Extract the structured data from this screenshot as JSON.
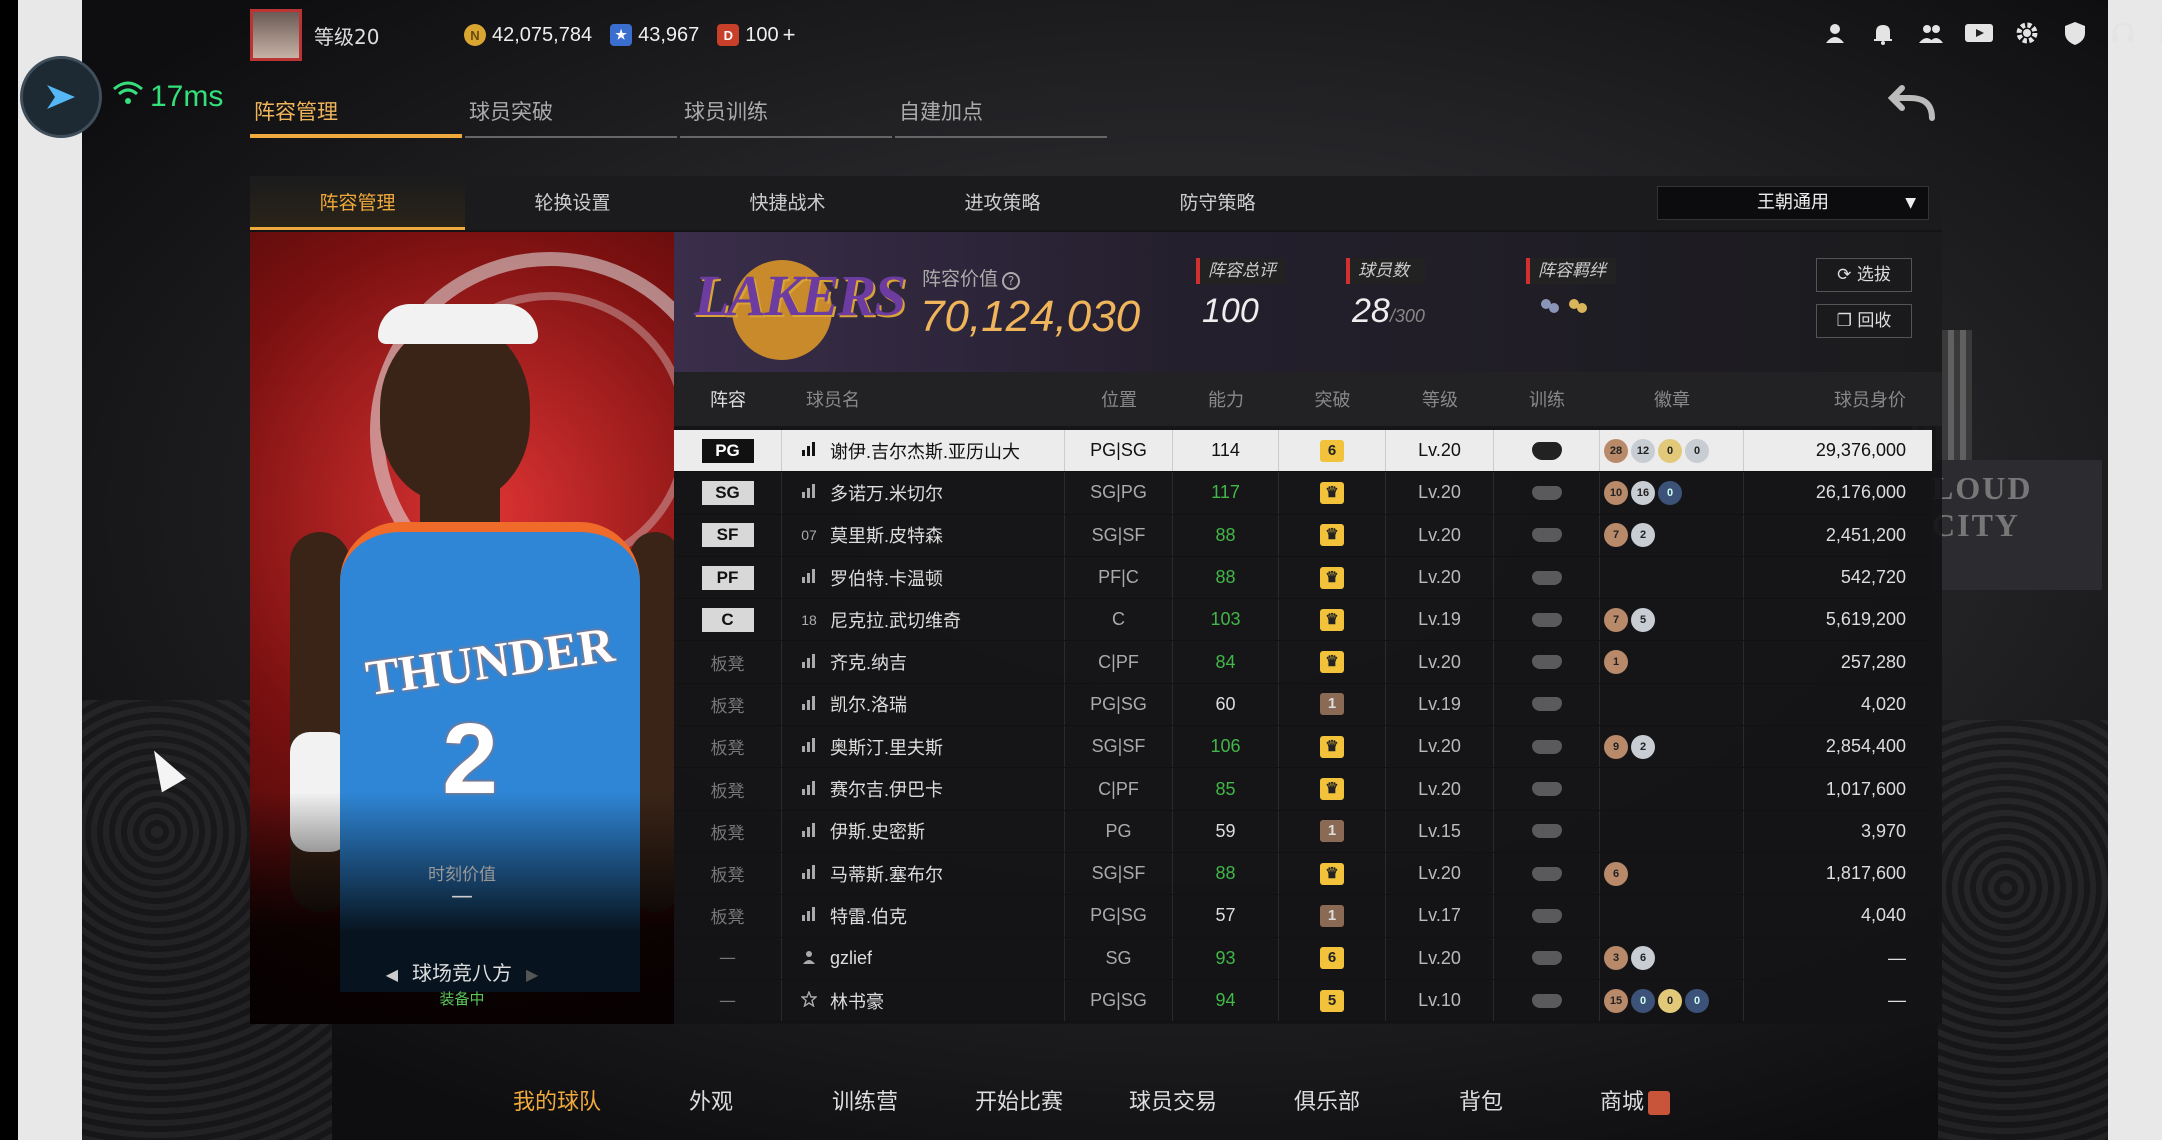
{
  "network": {
    "ping": "17ms"
  },
  "player_bar": {
    "level": "等级20",
    "gold": "42,075,784",
    "stars": "43,967",
    "tokens": "100",
    "plus": "+"
  },
  "top_icons": [
    "profile-icon",
    "bell-icon",
    "friends-icon",
    "video-icon",
    "gear-icon",
    "shield-icon",
    "headset-icon",
    "exit-icon"
  ],
  "main_tabs": [
    {
      "label": "阵容管理",
      "active": true
    },
    {
      "label": "球员突破",
      "active": false
    },
    {
      "label": "球员训练",
      "active": false
    },
    {
      "label": "自建加点",
      "active": false
    }
  ],
  "sub_tabs": [
    {
      "label": "阵容管理",
      "active": true
    },
    {
      "label": "轮换设置",
      "active": false
    },
    {
      "label": "快捷战术",
      "active": false
    },
    {
      "label": "进攻策略",
      "active": false
    },
    {
      "label": "防守策略",
      "active": false
    }
  ],
  "dropdown": {
    "selected": "王朝通用"
  },
  "card": {
    "moment_label": "时刻价值",
    "moment_value": "—",
    "card_name": "球场竞八方",
    "equipped": "装备中"
  },
  "team": {
    "logo_text": "LAKERS",
    "lineup_value_label": "阵容价值",
    "lineup_value": "70,124,030",
    "rating_label": "阵容总评",
    "rating": "100",
    "players_label": "球员数",
    "players": "28",
    "players_max": "/300",
    "bond_label": "阵容羁绊",
    "scout_btn": "选拔",
    "recycle_btn": "回收"
  },
  "table": {
    "headers": [
      "阵容",
      "球员名",
      "位置",
      "能力",
      "突破",
      "等级",
      "训练",
      "徽章",
      "球员身价"
    ],
    "rows": [
      {
        "slot": "PG",
        "name": "谢伊.吉尔杰斯.亚历山大",
        "pos": "PG|SG",
        "ability": "114",
        "ability_green": false,
        "break": "6",
        "break_style": "gold",
        "level": "Lv.20",
        "badges": [
          [
            "28",
            "bronze"
          ],
          [
            "12",
            "silver"
          ],
          [
            "0",
            "gold"
          ],
          [
            "0",
            "silver"
          ]
        ],
        "value": "29,376,000",
        "selected": true
      },
      {
        "slot": "SG",
        "name": "多诺万.米切尔",
        "pos": "SG|PG",
        "ability": "117",
        "ability_green": true,
        "break": "♛",
        "break_style": "gold",
        "level": "Lv.20",
        "badges": [
          [
            "10",
            "bronze"
          ],
          [
            "16",
            "silver"
          ],
          [
            "0",
            "blue"
          ]
        ],
        "value": "26,176,000"
      },
      {
        "slot": "SF",
        "name": "莫里斯.皮特森",
        "num": "07",
        "pos": "SG|SF",
        "ability": "88",
        "ability_green": true,
        "break": "♛",
        "break_style": "gold",
        "level": "Lv.20",
        "badges": [
          [
            "7",
            "bronze"
          ],
          [
            "2",
            "silver"
          ]
        ],
        "value": "2,451,200"
      },
      {
        "slot": "PF",
        "name": "罗伯特.卡温顿",
        "pos": "PF|C",
        "ability": "88",
        "ability_green": true,
        "break": "♛",
        "break_style": "gold",
        "level": "Lv.20",
        "badges": [],
        "value": "542,720"
      },
      {
        "slot": "C",
        "name": "尼克拉.武切维奇",
        "num": "18",
        "pos": "C",
        "ability": "103",
        "ability_green": true,
        "break": "♛",
        "break_style": "gold",
        "level": "Lv.19",
        "badges": [
          [
            "7",
            "bronze"
          ],
          [
            "5",
            "silver"
          ]
        ],
        "value": "5,619,200"
      },
      {
        "slot": "板凳",
        "name": "齐克.纳吉",
        "pos": "C|PF",
        "ability": "84",
        "ability_green": true,
        "break": "♛",
        "break_style": "gold",
        "level": "Lv.20",
        "badges": [
          [
            "1",
            "bronze"
          ]
        ],
        "value": "257,280"
      },
      {
        "slot": "板凳",
        "name": "凯尔.洛瑞",
        "pos": "PG|SG",
        "ability": "60",
        "ability_green": false,
        "break": "1",
        "break_style": "brown",
        "level": "Lv.19",
        "badges": [],
        "value": "4,020"
      },
      {
        "slot": "板凳",
        "name": "奥斯汀.里夫斯",
        "pos": "SG|SF",
        "ability": "106",
        "ability_green": true,
        "break": "♛",
        "break_style": "gold",
        "level": "Lv.20",
        "badges": [
          [
            "9",
            "bronze"
          ],
          [
            "2",
            "silver"
          ]
        ],
        "value": "2,854,400"
      },
      {
        "slot": "板凳",
        "name": "赛尔吉.伊巴卡",
        "pos": "C|PF",
        "ability": "85",
        "ability_green": true,
        "break": "♛",
        "break_style": "gold",
        "level": "Lv.20",
        "badges": [],
        "value": "1,017,600"
      },
      {
        "slot": "板凳",
        "name": "伊斯.史密斯",
        "pos": "PG",
        "ability": "59",
        "ability_green": false,
        "break": "1",
        "break_style": "brown",
        "level": "Lv.15",
        "badges": [],
        "value": "3,970"
      },
      {
        "slot": "板凳",
        "name": "马蒂斯.塞布尔",
        "pos": "SG|SF",
        "ability": "88",
        "ability_green": true,
        "break": "♛",
        "break_style": "gold",
        "level": "Lv.20",
        "badges": [
          [
            "6",
            "bronze"
          ]
        ],
        "value": "1,817,600"
      },
      {
        "slot": "板凳",
        "name": "特雷.伯克",
        "pos": "PG|SG",
        "ability": "57",
        "ability_green": false,
        "break": "1",
        "break_style": "brown",
        "level": "Lv.17",
        "badges": [],
        "value": "4,040"
      },
      {
        "slot": "—",
        "name": "gzlief",
        "icon": "person",
        "pos": "SG",
        "ability": "93",
        "ability_green": true,
        "break": "6",
        "break_style": "gold",
        "level": "Lv.20",
        "badges": [
          [
            "3",
            "bronze"
          ],
          [
            "6",
            "silver"
          ]
        ],
        "value": "—"
      },
      {
        "slot": "—",
        "name": "林书豪",
        "icon": "star",
        "pos": "PG|SG",
        "ability": "94",
        "ability_green": true,
        "break": "5",
        "break_style": "gold",
        "level": "Lv.10",
        "badges": [
          [
            "15",
            "bronze"
          ],
          [
            "0",
            "blue"
          ],
          [
            "0",
            "gold"
          ],
          [
            "0",
            "blue"
          ]
        ],
        "value": "—"
      }
    ]
  },
  "bottom_nav": [
    {
      "label": "我的球队",
      "active": true
    },
    {
      "label": "外观",
      "active": false
    },
    {
      "label": "训练营",
      "active": false
    },
    {
      "label": "开始比赛",
      "active": false
    },
    {
      "label": "球员交易",
      "active": false
    },
    {
      "label": "俱乐部",
      "active": false
    },
    {
      "label": "背包",
      "active": false
    },
    {
      "label": "商城",
      "active": false
    }
  ],
  "colors": {
    "accent": "#f0a93c",
    "green": "#43b649",
    "gold_badge": "#f2c23a"
  }
}
